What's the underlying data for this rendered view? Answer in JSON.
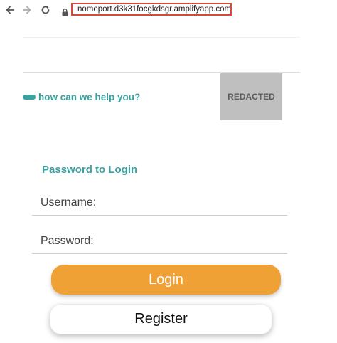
{
  "browser": {
    "url": "nomeport.d3k31focgkdsgr.amplifyapp.com",
    "icons": {
      "back": "back-arrow-icon",
      "forward": "forward-arrow-icon",
      "reload": "reload-icon",
      "lock": "lock-icon"
    }
  },
  "help": {
    "text": "how can we help you?"
  },
  "redacted_label": "REDACTED",
  "login_form": {
    "title": "Password to Login",
    "username_label": "Username:",
    "username_value": "",
    "password_label": "Password:",
    "password_value": "",
    "login_button": "Login",
    "register_button": "Register"
  },
  "colors": {
    "accent": "#3aa1a1",
    "login_button": "#f0a135",
    "url_highlight": "#d9483b",
    "redacted_box": "#bfbfbf"
  }
}
